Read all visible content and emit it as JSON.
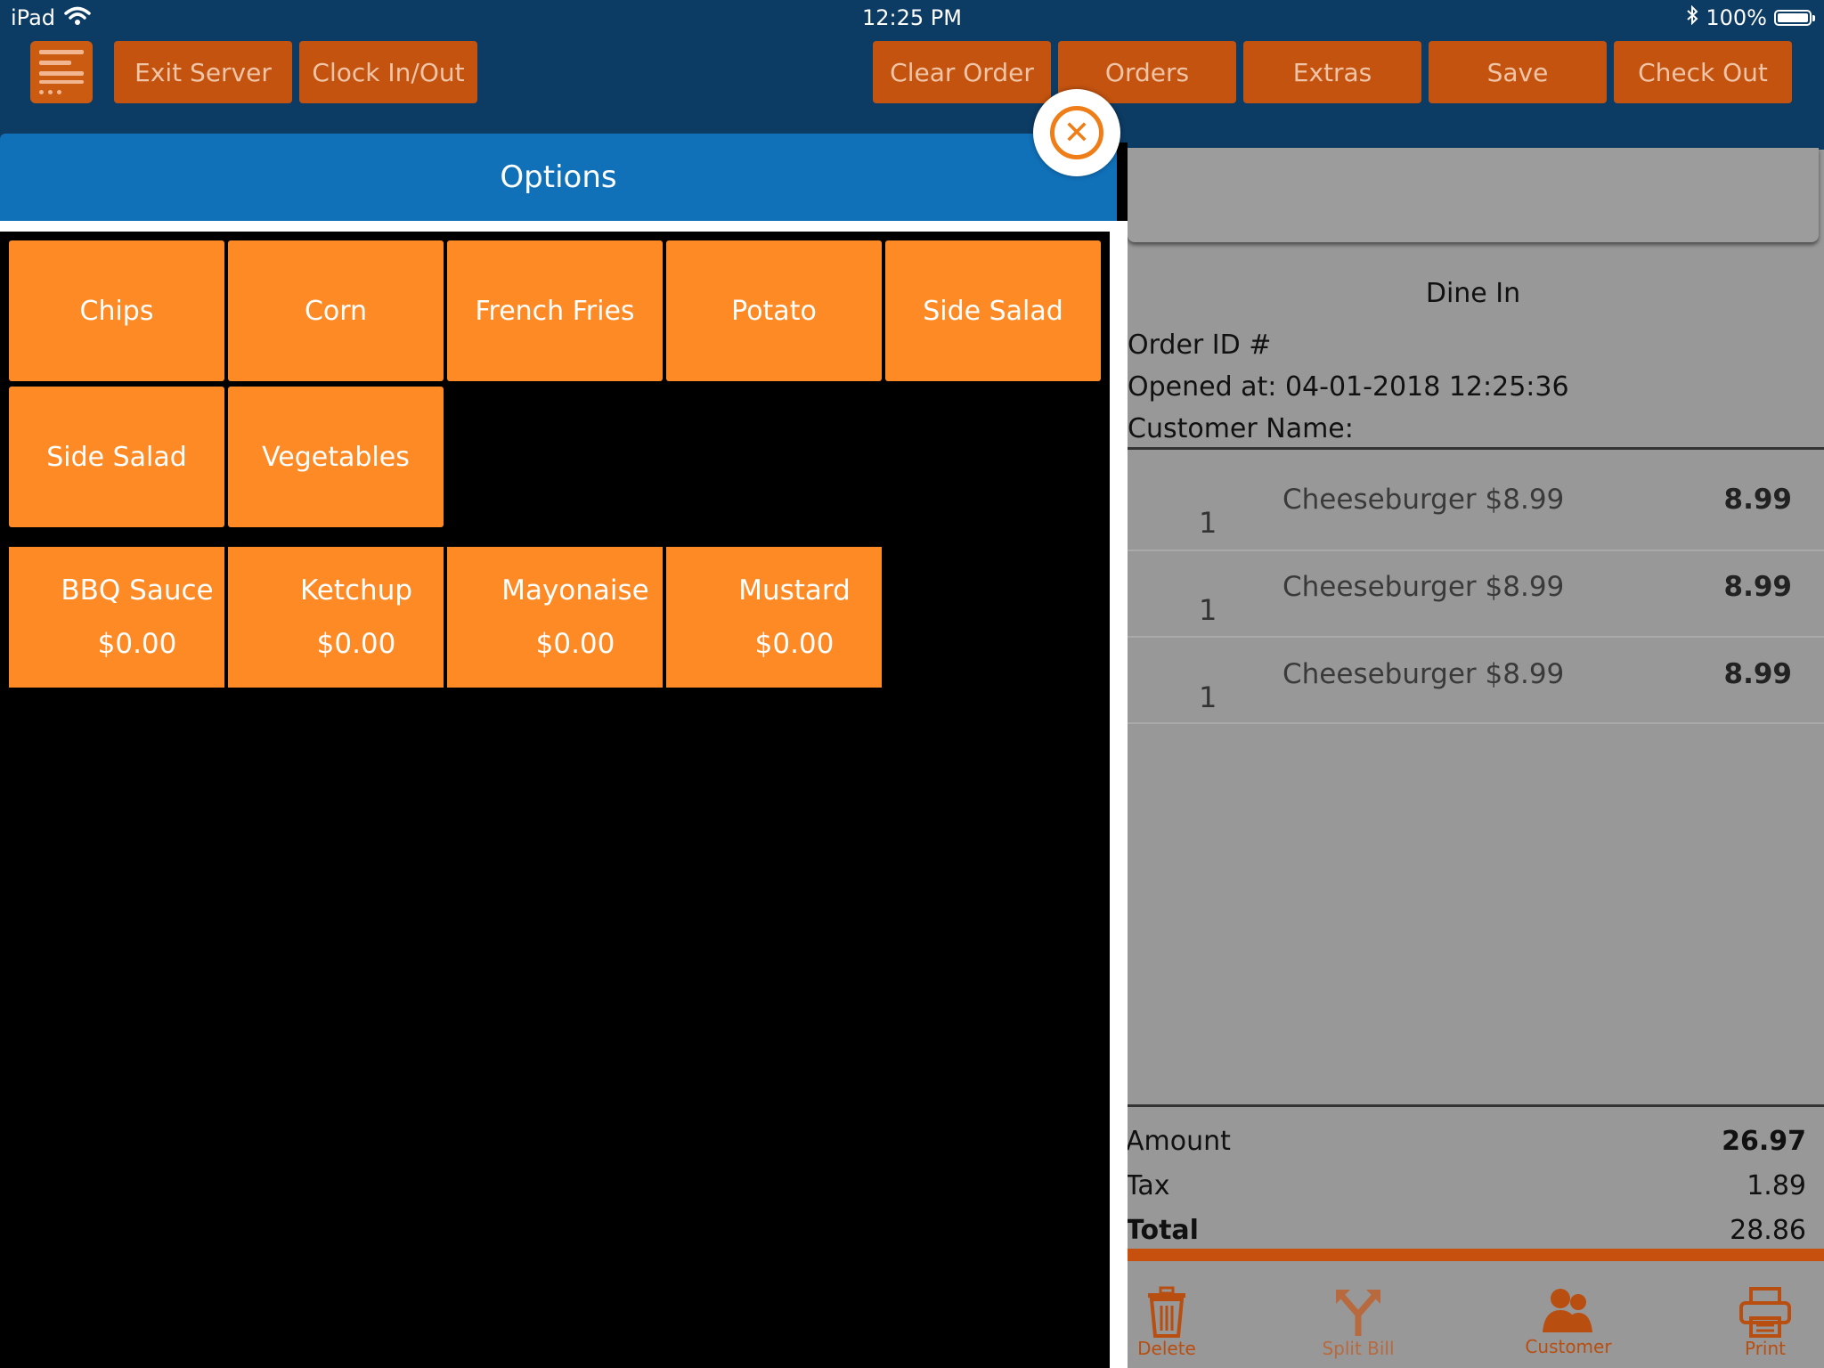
{
  "status_bar": {
    "device": "iPad",
    "time": "12:25 PM",
    "battery": "100%",
    "battery_level": 1.0
  },
  "toolbar": {
    "exit_server": "Exit Server",
    "clock_in_out": "Clock In/Out",
    "clear_order": "Clear Order",
    "orders": "Orders",
    "extras": "Extras",
    "save": "Save",
    "check_out": "Check Out"
  },
  "options": {
    "title": "Options",
    "sides": [
      "Chips",
      "Corn",
      "French Fries",
      "Potato",
      "Side Salad",
      "Side Salad",
      "Vegetables"
    ],
    "sauces": [
      {
        "name": "BBQ Sauce",
        "price": "$0.00"
      },
      {
        "name": "Ketchup",
        "price": "$0.00"
      },
      {
        "name": "Mayonaise",
        "price": "$0.00"
      },
      {
        "name": "Mustard",
        "price": "$0.00"
      }
    ]
  },
  "order": {
    "type": "Dine In",
    "order_id": "Order ID #",
    "opened_at": "Opened at: 04-01-2018 12:25:36",
    "customer_name": "Customer Name:",
    "items": [
      {
        "qty": "1",
        "name": "Cheeseburger $8.99",
        "price": "8.99"
      },
      {
        "qty": "1",
        "name": "Cheeseburger $8.99",
        "price": "8.99"
      },
      {
        "qty": "1",
        "name": "Cheeseburger $8.99",
        "price": "8.99"
      }
    ],
    "summary": {
      "amount_label": "Amount",
      "amount": "26.97",
      "tax_label": "Tax",
      "tax": "1.89",
      "total_label": "Total",
      "total": "28.86"
    }
  },
  "actions": {
    "delete": "Delete",
    "split_bill": "Split Bill",
    "customer": "Customer",
    "print": "Print"
  },
  "icons": [
    "wifi-icon",
    "bluetooth-icon",
    "battery-icon",
    "menu-icon",
    "close-icon",
    "trash-icon",
    "split-icon",
    "customer-icon",
    "printer-icon"
  ],
  "colors": {
    "topbar": "#0c3b63",
    "toolbar_button": "#c3530f",
    "option_button": "#fe8a26",
    "options_header": "#1070b8",
    "order_panel": "#989898"
  }
}
